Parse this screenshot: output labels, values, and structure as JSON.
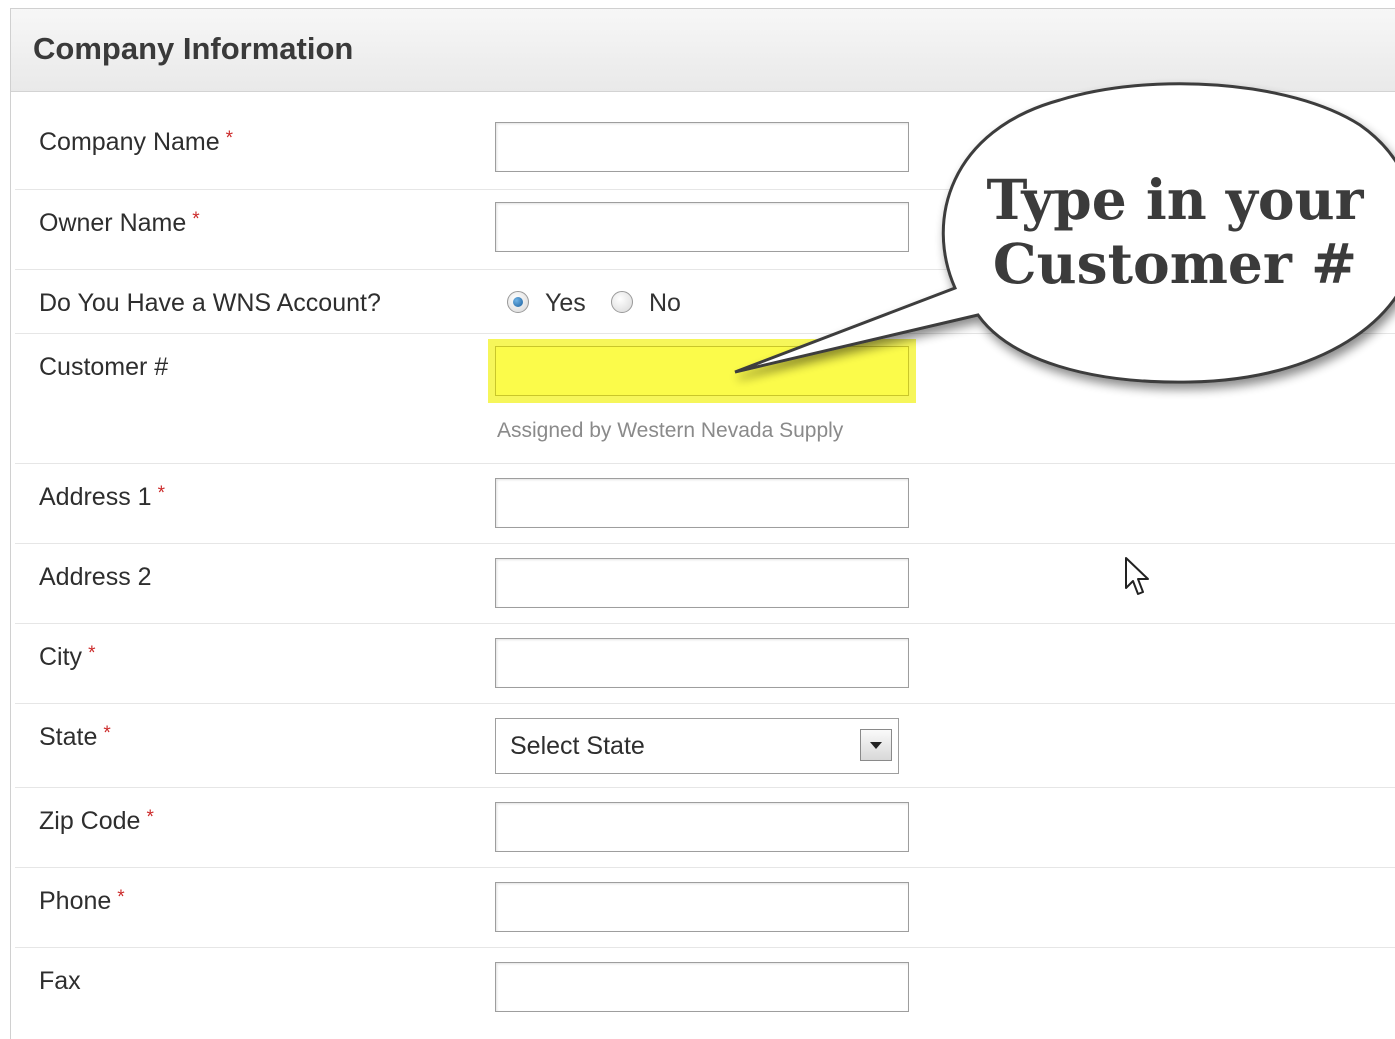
{
  "panel": {
    "title": "Company Information"
  },
  "required_marker": "*",
  "fields": {
    "company_name": {
      "label": "Company Name",
      "value": ""
    },
    "owner_name": {
      "label": "Owner Name",
      "value": ""
    },
    "wns_account": {
      "label": "Do You Have a WNS Account?",
      "yes_label": "Yes",
      "no_label": "No",
      "selected": "Yes"
    },
    "customer_number": {
      "label": "Customer #",
      "value": "",
      "hint": "Assigned by Western Nevada Supply"
    },
    "address1": {
      "label": "Address 1",
      "value": ""
    },
    "address2": {
      "label": "Address 2",
      "value": ""
    },
    "city": {
      "label": "City",
      "value": ""
    },
    "state": {
      "label": "State",
      "selected": "Select State"
    },
    "zip": {
      "label": "Zip Code",
      "value": ""
    },
    "phone": {
      "label": "Phone",
      "value": ""
    },
    "fax": {
      "label": "Fax",
      "value": ""
    }
  },
  "callout": {
    "line1": "Type in your",
    "line2": "Customer #"
  },
  "colors": {
    "highlight": "#fbfb4a",
    "required": "#cc2a2a",
    "radio_selected": "#1a5f9e"
  },
  "icons": {
    "cursor": "mouse-pointer-icon",
    "dropdown": "chevron-down-icon"
  }
}
